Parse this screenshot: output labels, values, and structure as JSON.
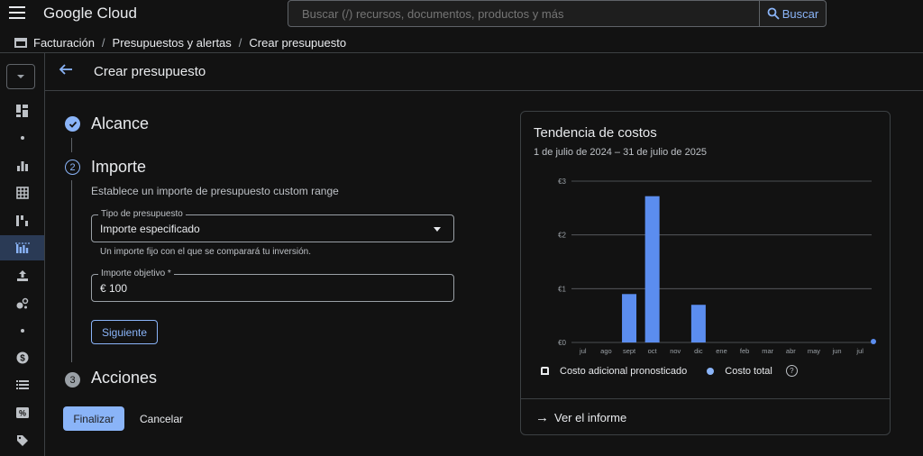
{
  "header": {
    "logo": "Google Cloud",
    "search_placeholder": "Buscar (/) recursos, documentos, productos y más",
    "search_button": "Buscar"
  },
  "breadcrumb": [
    "Facturación",
    "Presupuestos y alertas",
    "Crear presupuesto"
  ],
  "leftnav": {
    "items": [
      "dashboard-icon",
      "dot",
      "bar-chart-icon",
      "table-icon",
      "waterfall-icon",
      "budget-icon",
      "export-icon",
      "pricing-icon",
      "dot",
      "dollar-icon",
      "list-icon",
      "percent-icon",
      "tag-icon"
    ],
    "active_index": 5
  },
  "page": {
    "title": "Crear presupuesto"
  },
  "steps": [
    {
      "title": "Alcance",
      "status": "done"
    },
    {
      "title": "Importe",
      "number": "2",
      "description": "Establece un importe de presupuesto custom range",
      "budget_type": {
        "label": "Tipo de presupuesto",
        "value": "Importe especificado",
        "hint": "Un importe fijo con el que se comparará tu inversión."
      },
      "target": {
        "label": "Importe objetivo *",
        "value": "€ 100"
      },
      "next_button": "Siguiente"
    },
    {
      "title": "Acciones",
      "number": "3"
    }
  ],
  "actions": {
    "finish": "Finalizar",
    "cancel": "Cancelar"
  },
  "card": {
    "title": "Tendencia de costos",
    "date_range": "1 de julio de 2024 – 31 de julio de 2025",
    "legend_forecast": "Costo adicional pronosticado",
    "legend_total": "Costo total",
    "help": "?",
    "report_link": "Ver el informe"
  },
  "chart_data": {
    "type": "bar",
    "categories": [
      "jul",
      "ago",
      "sept",
      "oct",
      "nov",
      "dic",
      "ene",
      "feb",
      "mar",
      "abr",
      "may",
      "jun",
      "jul"
    ],
    "series": [
      {
        "name": "Costo total",
        "values": [
          0,
          0,
          0.9,
          2.72,
          0,
          0.7,
          0,
          0,
          0,
          0,
          0,
          0,
          0
        ]
      }
    ],
    "yticks": [
      "€0",
      "€1",
      "€2",
      "€3"
    ],
    "ylim": [
      0,
      3
    ],
    "grid": true,
    "colors": {
      "bar": "#5b8def",
      "grid": "#5f6368",
      "marker": "#5b8def"
    }
  }
}
